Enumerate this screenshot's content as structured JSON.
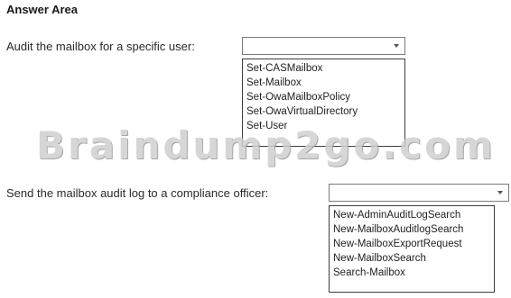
{
  "heading": "Answer Area",
  "questions": [
    {
      "label": "Audit the mailbox for a specific user:",
      "selected": "",
      "options": [
        "Set-CASMailbox",
        "Set-Mailbox",
        "Set-OwaMailboxPolicy",
        "Set-OwaVirtualDirectory",
        "Set-User"
      ]
    },
    {
      "label": "Send the mailbox audit log to a compliance officer:",
      "selected": "",
      "options": [
        "New-AdminAuditLogSearch",
        "New-MailboxAuditlogSearch",
        "New-MailboxExportRequest",
        "New-MailboxSearch",
        "Search-Mailbox"
      ]
    }
  ],
  "watermark": "Braindump2go.com",
  "icons": {
    "dropdown": "chevron-down-icon"
  },
  "colors": {
    "border": "#7a7a7a",
    "list_border": "#3c3c3c",
    "watermark": "#cfcfcf"
  }
}
